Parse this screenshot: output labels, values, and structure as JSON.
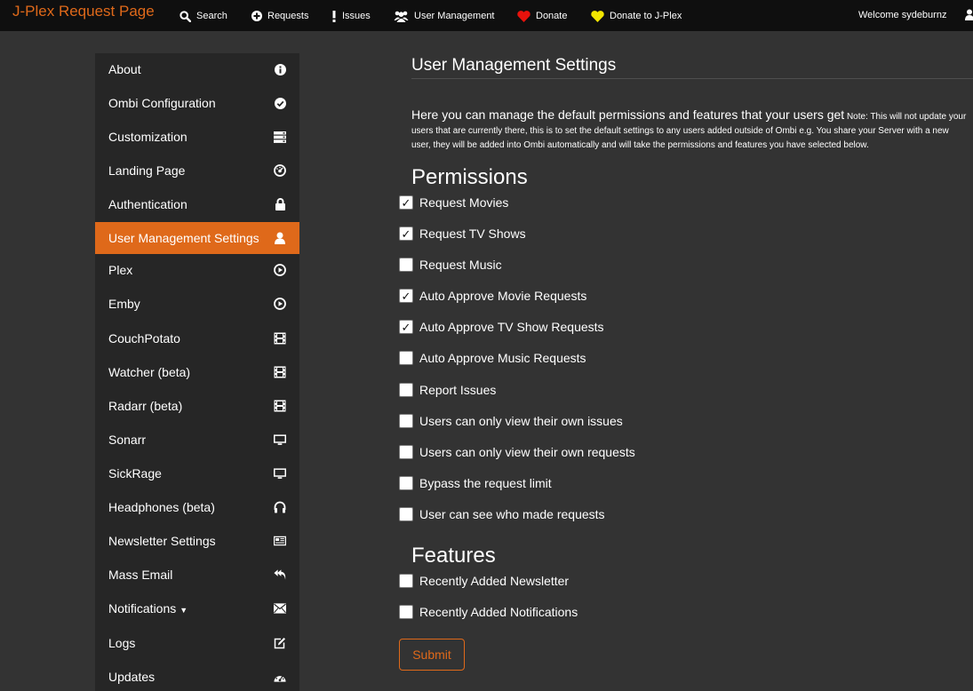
{
  "navbar": {
    "brand": "J-Plex Request Page",
    "items": [
      {
        "label": "Search",
        "icon": "search-icon"
      },
      {
        "label": "Requests",
        "icon": "plus-circle-icon"
      },
      {
        "label": "Issues",
        "icon": "exclamation-icon"
      },
      {
        "label": "User Management",
        "icon": "users-icon"
      },
      {
        "label": "Donate",
        "icon": "heart-icon"
      },
      {
        "label": "Donate to J-Plex",
        "icon": "heart-icon"
      }
    ],
    "welcome": "Welcome sydeburnz",
    "user_icon": "user-icon"
  },
  "colors": {
    "accent": "#df691a",
    "navbar_bg": "#0f0f0f",
    "page_bg": "#333333",
    "sidebar_bg": "#262626",
    "heart_red": "#e8120c",
    "heart_yellow": "#f2e600"
  },
  "sidebar": {
    "items": [
      {
        "label": "About",
        "icon": "info-icon"
      },
      {
        "label": "Ombi Configuration",
        "icon": "check-circle-icon"
      },
      {
        "label": "Customization",
        "icon": "server-icon"
      },
      {
        "label": "Landing Page",
        "icon": "dashboard-icon"
      },
      {
        "label": "Authentication",
        "icon": "lock-icon"
      },
      {
        "label": "User Management Settings",
        "icon": "user-icon",
        "active": true
      },
      {
        "label": "Plex",
        "icon": "play-circle-icon"
      },
      {
        "label": "Emby",
        "icon": "play-circle-icon"
      },
      {
        "label": "CouchPotato",
        "icon": "film-icon"
      },
      {
        "label": "Watcher (beta)",
        "icon": "film-icon"
      },
      {
        "label": "Radarr (beta)",
        "icon": "film-icon"
      },
      {
        "label": "Sonarr",
        "icon": "monitor-icon"
      },
      {
        "label": "SickRage",
        "icon": "monitor-icon"
      },
      {
        "label": "Headphones (beta)",
        "icon": "headphones-icon"
      },
      {
        "label": "Newsletter Settings",
        "icon": "newspaper-icon"
      },
      {
        "label": "Mass Email",
        "icon": "reply-all-icon"
      },
      {
        "label": "Notifications",
        "icon": "envelope-icon",
        "dropdown": true
      },
      {
        "label": "Logs",
        "icon": "edit-icon"
      },
      {
        "label": "Updates",
        "icon": "dashboard-icon"
      }
    ]
  },
  "main": {
    "title": "User Management Settings",
    "intro_main": "Here you can manage the default permissions and features that your users get",
    "intro_note": "Note: This will not update your users that are currently there, this is to set the default settings to any users added outside of Ombi e.g. You share your Server with a new user, they will be added into Ombi automatically and will take the permissions and features you have selected below.",
    "permissions_title": "Permissions",
    "permissions": [
      {
        "label": "Request Movies",
        "checked": true
      },
      {
        "label": "Request TV Shows",
        "checked": true
      },
      {
        "label": "Request Music",
        "checked": false
      },
      {
        "label": "Auto Approve Movie Requests",
        "checked": true
      },
      {
        "label": "Auto Approve TV Show Requests",
        "checked": true
      },
      {
        "label": "Auto Approve Music Requests",
        "checked": false
      },
      {
        "label": "Report Issues",
        "checked": false
      },
      {
        "label": "Users can only view their own issues",
        "checked": false
      },
      {
        "label": "Users can only view their own requests",
        "checked": false
      },
      {
        "label": "Bypass the request limit",
        "checked": false
      },
      {
        "label": "User can see who made requests",
        "checked": false
      }
    ],
    "features_title": "Features",
    "features": [
      {
        "label": "Recently Added Newsletter",
        "checked": false
      },
      {
        "label": "Recently Added Notifications",
        "checked": false
      }
    ],
    "submit_label": "Submit",
    "check_mark": "✓"
  }
}
